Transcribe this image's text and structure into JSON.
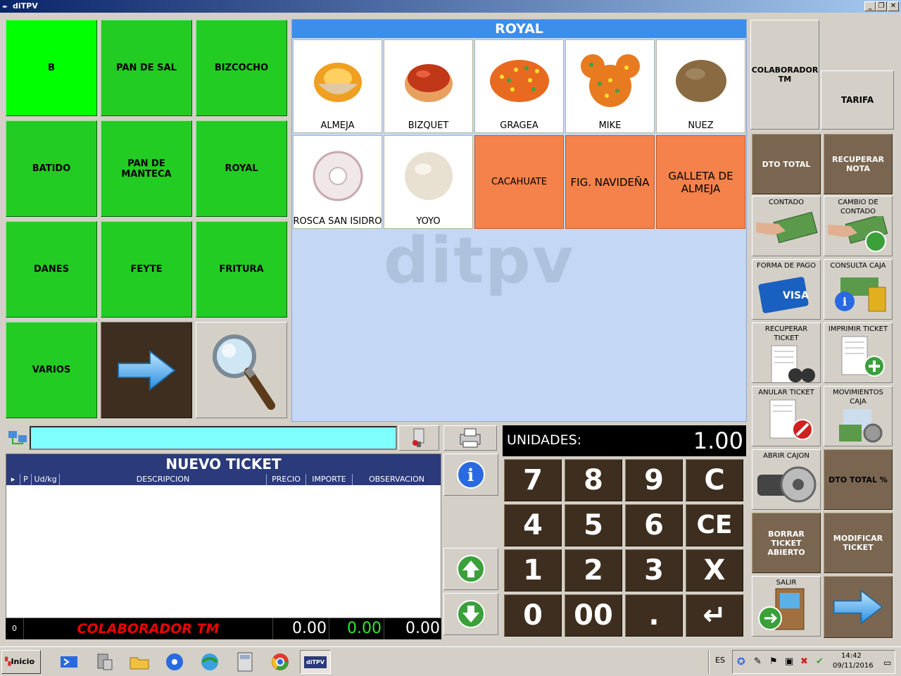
{
  "window": {
    "title": "diTPV"
  },
  "families": [
    {
      "label": "B",
      "selected": true
    },
    {
      "label": "PAN DE SAL"
    },
    {
      "label": "BIZCOCHO"
    },
    {
      "label": "BATIDO"
    },
    {
      "label": "PAN DE MANTECA"
    },
    {
      "label": "ROYAL"
    },
    {
      "label": "DANES"
    },
    {
      "label": "FEYTE"
    },
    {
      "label": "FRITURA"
    },
    {
      "label": "VARIOS"
    }
  ],
  "products": {
    "title": "ROYAL",
    "items": [
      {
        "label": "ALMEJA"
      },
      {
        "label": "BIZQUET"
      },
      {
        "label": "GRAGEA"
      },
      {
        "label": "MIKE"
      },
      {
        "label": "NUEZ"
      },
      {
        "label": "ROSCA SAN ISIDRO"
      },
      {
        "label": "YOYO"
      },
      {
        "label": "CACAHUATE"
      },
      {
        "label": "FIG. NAVIDEÑA"
      },
      {
        "label": "GALLETA DE ALMEJA"
      }
    ]
  },
  "right_panel": {
    "colaborador": "COLABORADOR TM",
    "tarifa": "TARIFA",
    "dto_total": "DTO TOTAL",
    "recuperar_nota": "RECUPERAR NOTA",
    "contado": "CONTADO",
    "cambio_contado": "CAMBIO DE CONTADO",
    "forma_pago": "FORMA DE PAGO",
    "consulta_caja": "CONSULTA CAJA",
    "recuperar_ticket": "RECUPERAR TICKET",
    "imprimir_ticket": "IMPRIMIR TICKET",
    "anular_ticket": "ANULAR TICKET",
    "movimientos_caja": "MOVIMIENTOS CAJA",
    "abrir_cajon": "ABRIR CAJON",
    "dto_total_pct": "DTO TOTAL %",
    "borrar_ticket": "BORRAR TICKET ABIERTO",
    "modificar_ticket": "MODIFICAR TICKET",
    "salir": "SALIR",
    "visa_text": "VISA"
  },
  "ticket": {
    "title": "NUEVO TICKET",
    "columns": [
      "P",
      "Ud/kg",
      "DESCRIPCION",
      "PRECIO",
      "IMPORTE",
      "OBSERVACION"
    ],
    "footer_count": "0",
    "footer_user": "COLABORADOR TM",
    "total1": "0.00",
    "total2": "0.00",
    "total3": "0.00"
  },
  "units": {
    "label": "UNIDADES:",
    "value": "1.00"
  },
  "keypad": [
    "7",
    "8",
    "9",
    "C",
    "4",
    "5",
    "6",
    "CE",
    "1",
    "2",
    "3",
    "X",
    "0",
    "00",
    ".",
    "↵"
  ],
  "watermark": "ditpv",
  "taskbar": {
    "start_label": "Inicio",
    "lang": "ES",
    "time": "14:42",
    "date": "09/11/2016",
    "active_app": "diTPV"
  },
  "colors": {
    "family_green": "#22cc22",
    "selected_green": "#00ff00",
    "product_orange": "#f5824a",
    "header_blue": "#3c8eea",
    "ticket_navy": "#2a3a7a"
  }
}
